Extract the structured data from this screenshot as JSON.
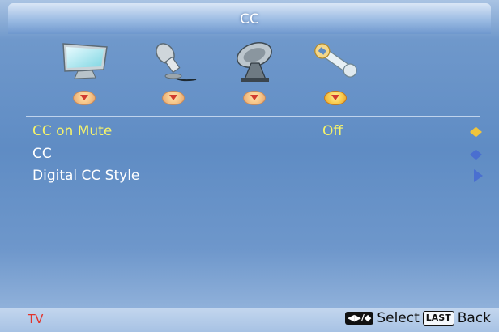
{
  "title": "CC",
  "icons": [
    {
      "name": "monitor-icon",
      "active": false
    },
    {
      "name": "microphone-icon",
      "active": false
    },
    {
      "name": "satellite-dish-icon",
      "active": false
    },
    {
      "name": "wrench-icon",
      "active": true
    }
  ],
  "menu": {
    "items": [
      {
        "label": "CC on Mute",
        "value": "Off",
        "selected": true,
        "control": "left-right"
      },
      {
        "label": "CC",
        "value": "",
        "selected": false,
        "control": "left-right"
      },
      {
        "label": "Digital CC Style",
        "value": "",
        "selected": false,
        "control": "enter"
      }
    ]
  },
  "footer": {
    "source": "TV",
    "select_key": "◀▶/◆",
    "select_label": "Select",
    "back_key": "LAST",
    "back_label": "Back"
  },
  "colors": {
    "selected_text": "#f6f36a",
    "normal_text": "#ffffff",
    "source_text": "#e2332b",
    "arrow": "#4a6fd0"
  }
}
